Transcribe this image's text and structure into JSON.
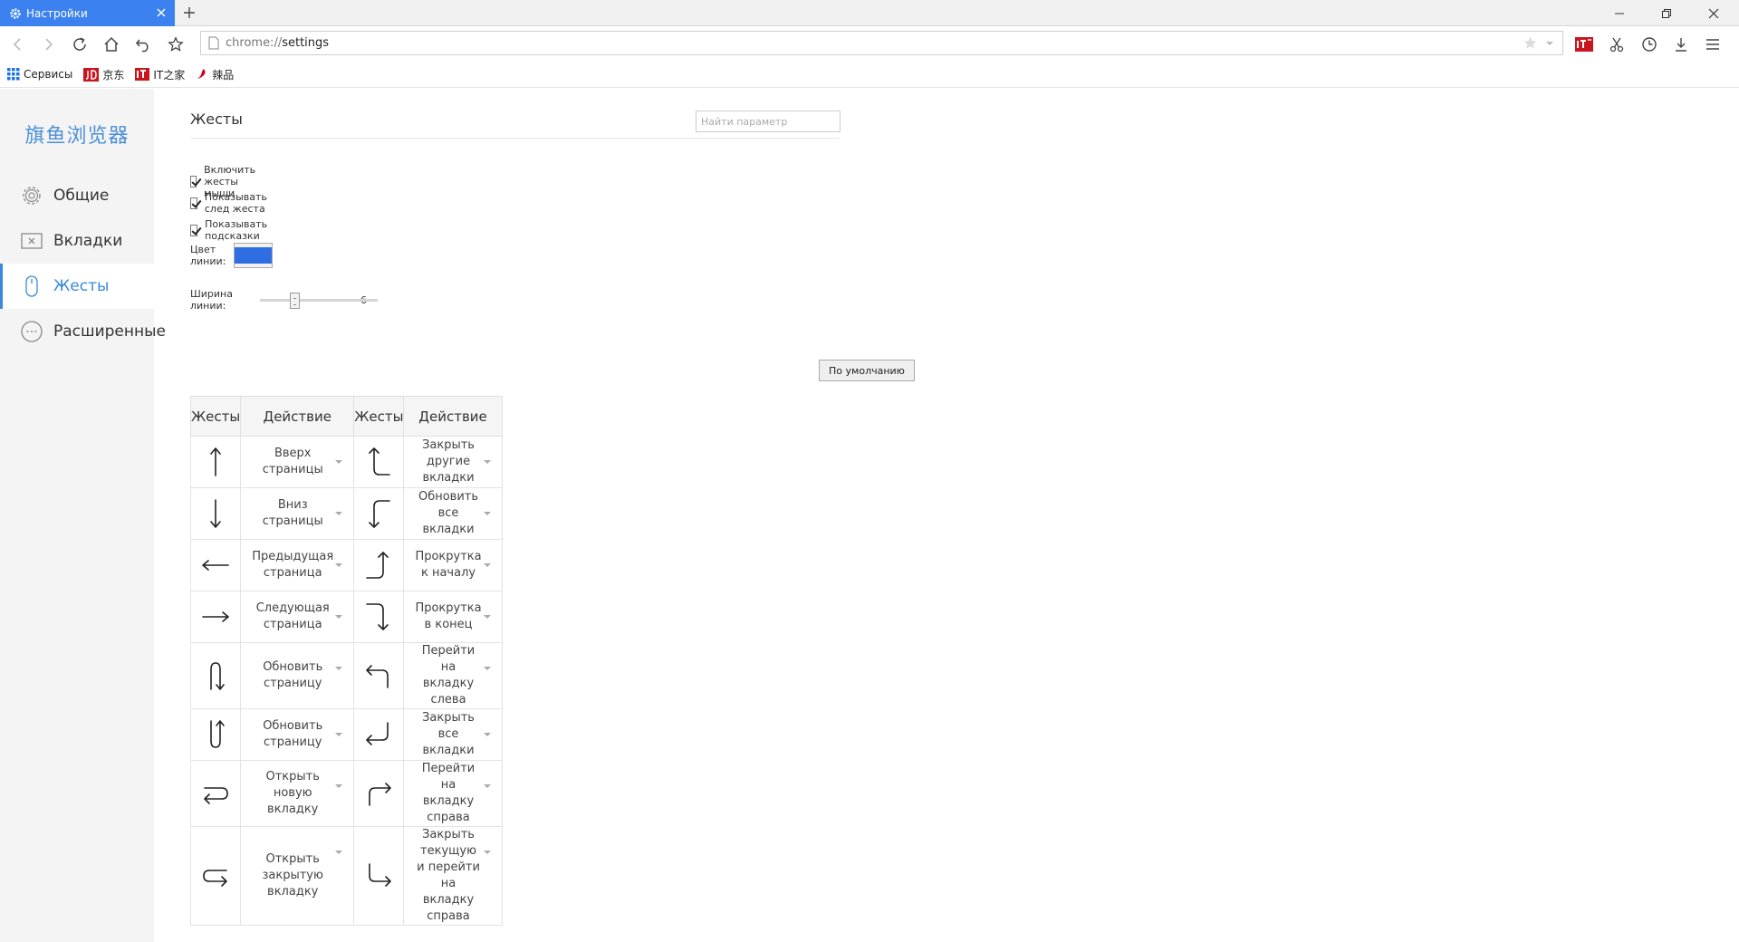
{
  "browser": {
    "tab_title": "Настройки",
    "url_scheme": "chrome://",
    "url_path": "settings",
    "bookmarks": [
      {
        "label": "Сервисы",
        "icon": "apps-grid-icon",
        "color": "#1a73e8"
      },
      {
        "label": "京东",
        "icon": "jd-logo-icon",
        "color": "#c9151e"
      },
      {
        "label": "IT之家",
        "icon": "ithome-logo-icon",
        "color": "#d0021b"
      },
      {
        "label": "辣品",
        "icon": "lapin-logo-icon",
        "color": "#d0021b"
      }
    ]
  },
  "sidebar": {
    "brand": "旗鱼浏览器",
    "items": [
      {
        "label": "Общие",
        "icon": "gear-icon"
      },
      {
        "label": "Вкладки",
        "icon": "tab-window-icon"
      },
      {
        "label": "Жесты",
        "icon": "mouse-icon",
        "active": true
      },
      {
        "label": "Расширенные",
        "icon": "more-circle-icon"
      }
    ]
  },
  "settings": {
    "title": "Жесты",
    "search_placeholder": "Найти параметр",
    "checkboxes": [
      {
        "label": "Включить жесты мыши",
        "checked": true
      },
      {
        "label": "Показывать след жеста",
        "checked": true
      },
      {
        "label": "Показывать подсказки",
        "checked": true
      }
    ],
    "line_color_label": "Цвет линии:",
    "line_color": "#2f6de3",
    "line_width_label": "Ширина линии:",
    "line_width_value": "6",
    "line_width_fraction": 0.28,
    "reset_label": "По умолчанию"
  },
  "table": {
    "headers": [
      "Жесты",
      "Действие",
      "Жесты",
      "Действие"
    ],
    "rows": [
      {
        "left_gesture": "up-arrow-gesture",
        "left_action": "Вверх страницы",
        "right_gesture": "down-up-hook-gesture",
        "right_action": "Закрыть другие вкладки"
      },
      {
        "left_gesture": "down-arrow-gesture",
        "left_action": "Вниз страницы",
        "right_gesture": "down-left-up-gesture",
        "right_action": "Обновить все вкладки"
      },
      {
        "left_gesture": "left-arrow-gesture",
        "left_action": "Предыдущая страница",
        "right_gesture": "right-up-gesture",
        "right_action": "Прокрутка к началу"
      },
      {
        "left_gesture": "right-arrow-gesture",
        "left_action": "Следующая страница",
        "right_gesture": "right-down-gesture",
        "right_action": "Прокрутка в конец"
      },
      {
        "left_gesture": "up-down-gesture",
        "left_action": "Обновить страницу",
        "right_gesture": "left-down-gesture",
        "right_action": "Перейти на вкладку слева"
      },
      {
        "left_gesture": "down-up-gesture",
        "left_action": "Обновить страницу",
        "right_gesture": "up-left-gesture",
        "right_action": "Закрыть все вкладки"
      },
      {
        "left_gesture": "right-left-loop-gesture",
        "left_action": "Открыть новую вкладку",
        "right_gesture": "up-right-gesture",
        "right_action": "Перейти на вкладку справа"
      },
      {
        "left_gesture": "left-right-loop-gesture",
        "left_action": "Открыть закрытую вкладку",
        "right_gesture": "down-right-gesture",
        "right_action": "Закрыть текущую и перейти на вкладку справа"
      }
    ]
  }
}
